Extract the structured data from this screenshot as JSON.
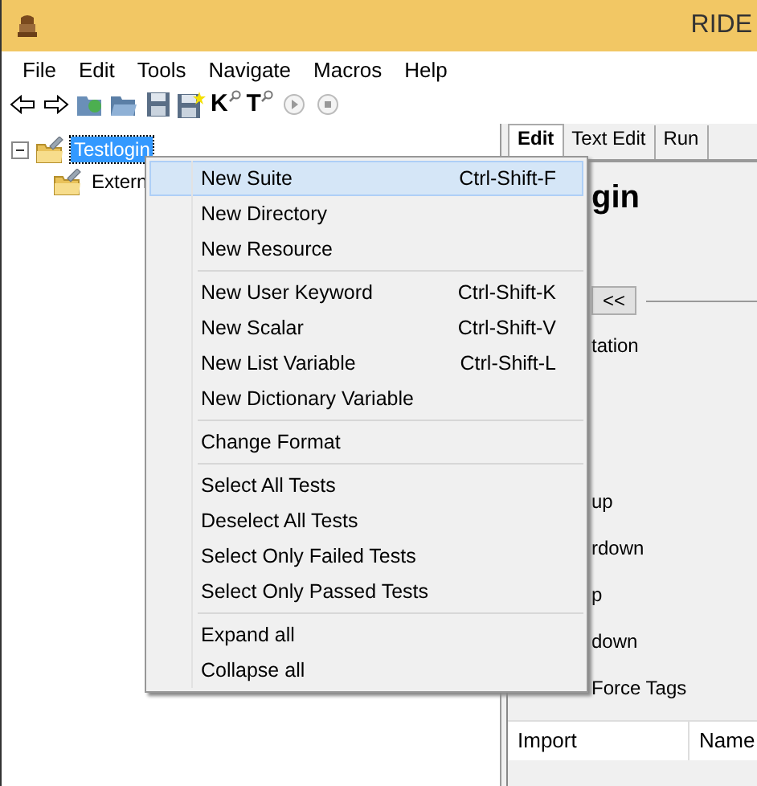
{
  "window": {
    "title": "RIDE"
  },
  "menubar": [
    "File",
    "Edit",
    "Tools",
    "Navigate",
    "Macros",
    "Help"
  ],
  "toolbar": [
    {
      "kind": "back"
    },
    {
      "kind": "forward"
    },
    {
      "kind": "open-folder"
    },
    {
      "kind": "folder"
    },
    {
      "kind": "save"
    },
    {
      "kind": "save-all"
    },
    {
      "kind": "letter-search",
      "label": "K"
    },
    {
      "kind": "letter-search",
      "label": "T"
    },
    {
      "kind": "play"
    },
    {
      "kind": "stop"
    }
  ],
  "tree": {
    "items": [
      {
        "label": "Testlogin",
        "selected": true,
        "expanded": true,
        "children": [
          {
            "label": "Extern",
            "selected": false
          }
        ]
      }
    ]
  },
  "editor": {
    "tabs": [
      {
        "label": "Edit",
        "selected": true
      },
      {
        "label": "Text Edit",
        "selected": false
      },
      {
        "label": "Run",
        "selected": false
      }
    ],
    "heading": "gin",
    "toggle_button": "<<",
    "labels": [
      "tation",
      "up",
      "rdown",
      "p",
      "down",
      "Force Tags"
    ],
    "table": {
      "columns": [
        "Import",
        "Name"
      ]
    }
  },
  "context_menu": {
    "groups": [
      [
        {
          "label": "New Suite",
          "shortcut": "Ctrl-Shift-F",
          "selected": true
        },
        {
          "label": "New Directory",
          "selected": false
        },
        {
          "label": "New Resource",
          "selected": false
        }
      ],
      [
        {
          "label": "New User Keyword",
          "shortcut": "Ctrl-Shift-K",
          "selected": false
        },
        {
          "label": "New Scalar",
          "shortcut": "Ctrl-Shift-V",
          "selected": false
        },
        {
          "label": "New List Variable",
          "shortcut": "Ctrl-Shift-L",
          "selected": false
        },
        {
          "label": "New Dictionary Variable",
          "selected": false
        }
      ],
      [
        {
          "label": "Change Format",
          "selected": false
        }
      ],
      [
        {
          "label": "Select All Tests",
          "selected": false
        },
        {
          "label": "Deselect All Tests",
          "selected": false
        },
        {
          "label": "Select Only Failed Tests",
          "selected": false
        },
        {
          "label": "Select Only Passed Tests",
          "selected": false
        }
      ],
      [
        {
          "label": "Expand all",
          "selected": false
        },
        {
          "label": "Collapse all",
          "selected": false
        }
      ]
    ]
  }
}
